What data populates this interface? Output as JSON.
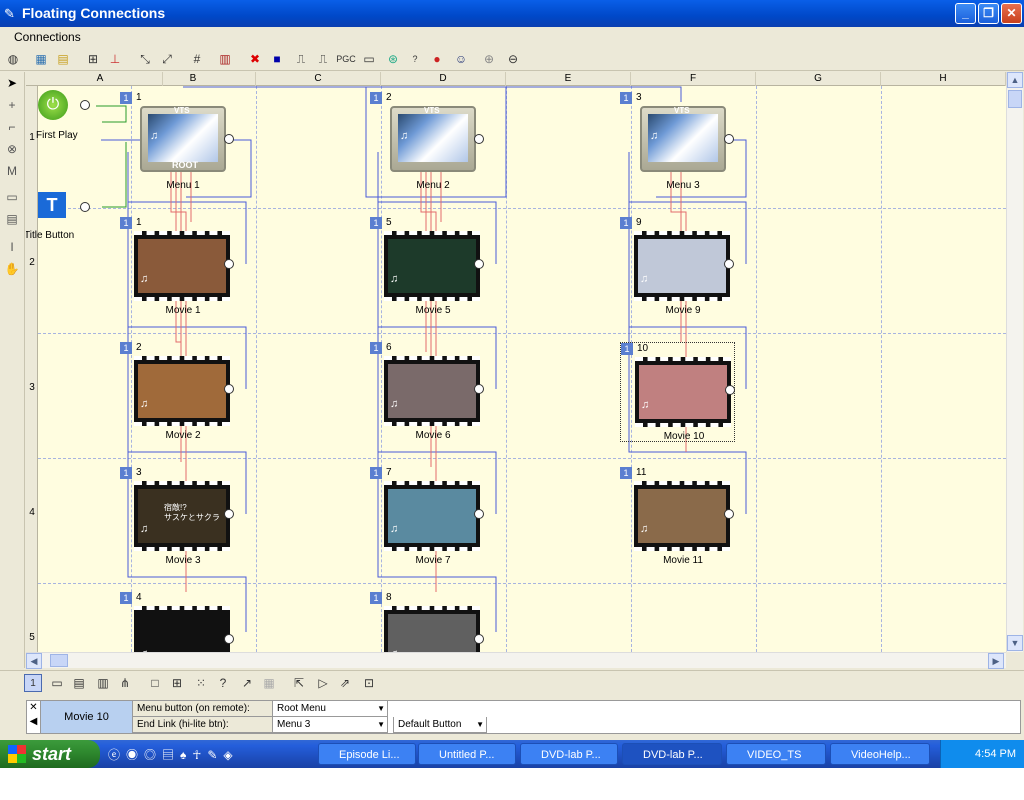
{
  "window": {
    "title": "Floating Connections"
  },
  "menu": {
    "connections": "Connections"
  },
  "toolbar": {
    "pgc": "PGC"
  },
  "grid": {
    "columns": [
      "A",
      "B",
      "C",
      "D",
      "E",
      "F",
      "G",
      "H"
    ],
    "rows": [
      "1",
      "2",
      "3",
      "4",
      "5"
    ]
  },
  "start_nodes": {
    "first_play": "First Play",
    "title_button": "Title Button"
  },
  "menus": [
    {
      "num": "1",
      "label": "Menu 1",
      "vts": "VTS",
      "root": "ROOT"
    },
    {
      "num": "2",
      "label": "Menu 2",
      "vts": "VTS"
    },
    {
      "num": "3",
      "label": "Menu 3",
      "vts": "VTS"
    }
  ],
  "movies": [
    {
      "num": "1",
      "label": "Movie 1",
      "color": "#8a5a3a"
    },
    {
      "num": "2",
      "label": "Movie 2",
      "color": "#a06a3a"
    },
    {
      "num": "3",
      "label": "Movie 3",
      "color": "#3a3020"
    },
    {
      "num": "4",
      "label": "",
      "color": "#111111"
    },
    {
      "num": "5",
      "label": "Movie 5",
      "color": "#1d3a2a"
    },
    {
      "num": "6",
      "label": "Movie 6",
      "color": "#7a6a6a"
    },
    {
      "num": "7",
      "label": "Movie 7",
      "color": "#5a8aa0"
    },
    {
      "num": "8",
      "label": "",
      "color": "#606060"
    },
    {
      "num": "9",
      "label": "Movie 9",
      "color": "#c0c8d8"
    },
    {
      "num": "10",
      "label": "Movie 10",
      "color": "#c08080"
    },
    {
      "num": "11",
      "label": "Movie 11",
      "color": "#8a6a4a"
    }
  ],
  "movie_overlay_text": {
    "movie3": "宿敵!?\nサスケとサクラ"
  },
  "bottom": {
    "page": "1"
  },
  "props": {
    "selected": "Movie 10",
    "menu_button_label": "Menu button (on remote):",
    "menu_button_value": "Root Menu",
    "end_link_label": "End Link (hi-lite btn):",
    "end_link_value": "Menu 3",
    "default_button": "Default Button"
  },
  "taskbar": {
    "start": "start",
    "tasks": [
      "Episode Li...",
      "Untitled P...",
      "DVD-lab P...",
      "DVD-lab P...",
      "VIDEO_TS",
      "VideoHelp..."
    ],
    "clock": "4:54 PM"
  }
}
